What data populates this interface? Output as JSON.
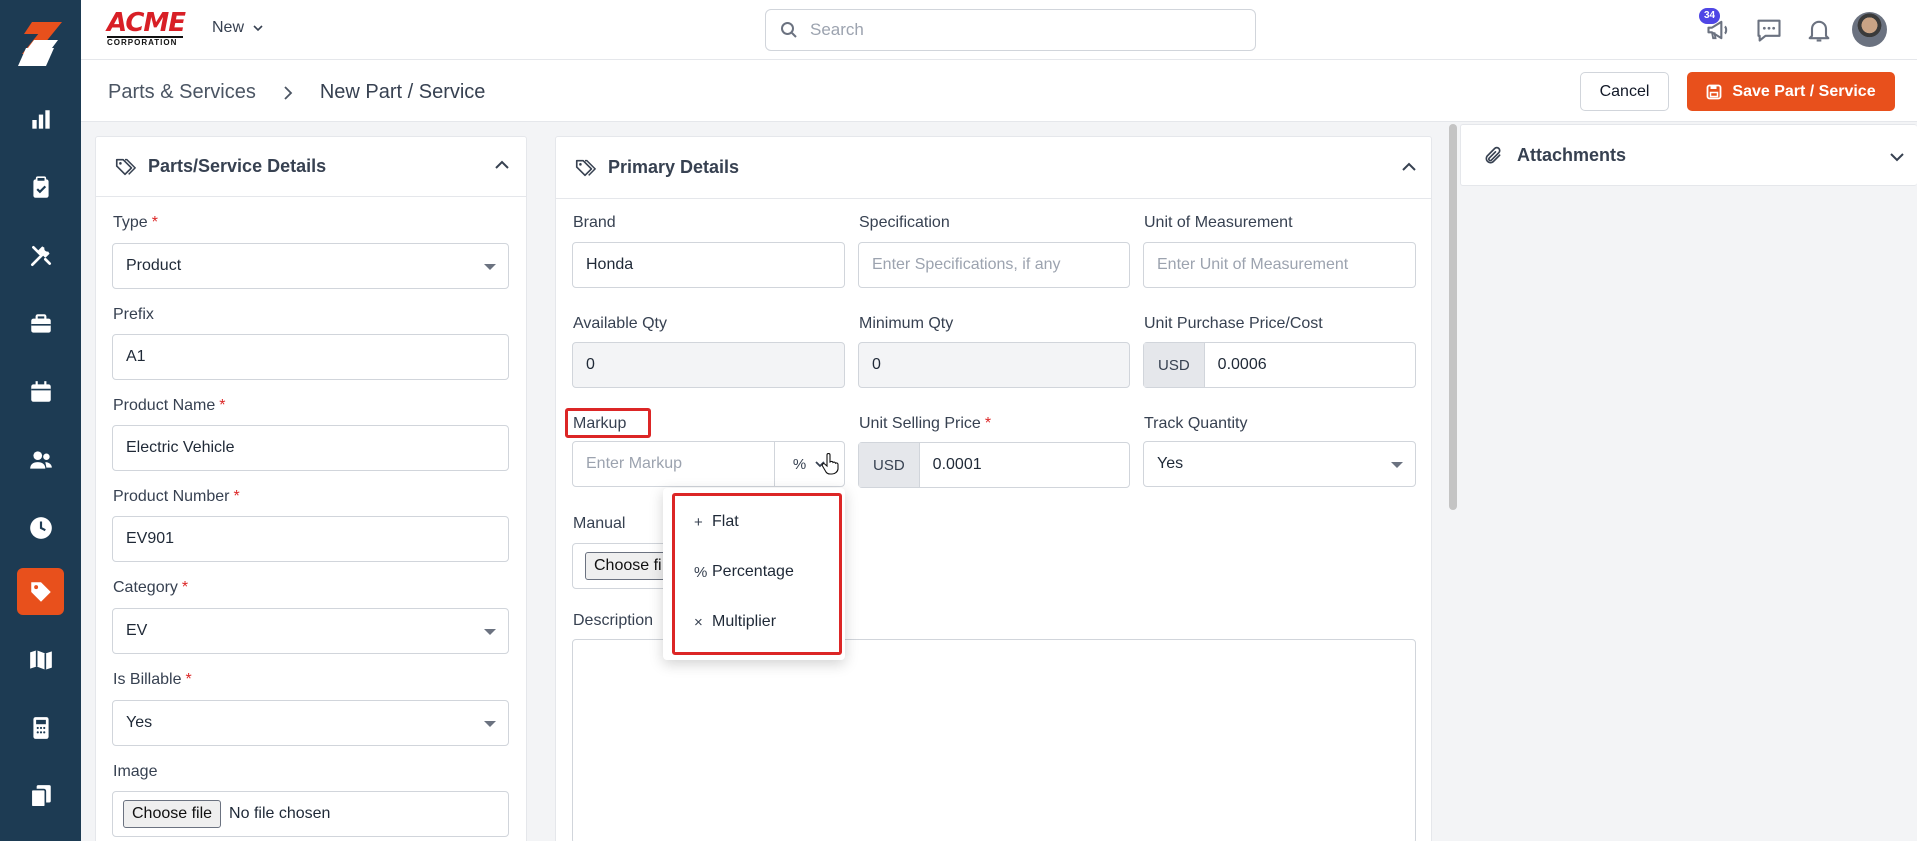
{
  "topbar": {
    "brand_main": "ACME",
    "brand_sub": "CORPORATION",
    "new_label": "New",
    "search_placeholder": "Search",
    "notification_count": "34"
  },
  "breadcrumb": {
    "parent": "Parts & Services",
    "current": "New Part / Service"
  },
  "actions": {
    "cancel": "Cancel",
    "save": "Save Part / Service"
  },
  "left_panel": {
    "title": "Parts/Service Details",
    "type_label": "Type",
    "type_value": "Product",
    "prefix_label": "Prefix",
    "prefix_value": "A1",
    "name_label": "Product Name",
    "name_value": "Electric Vehicle",
    "number_label": "Product Number",
    "number_value": "EV901",
    "category_label": "Category",
    "category_value": "EV",
    "billable_label": "Is Billable",
    "billable_value": "Yes",
    "image_label": "Image",
    "image_button": "Choose file",
    "image_status": "No file chosen"
  },
  "primary": {
    "title": "Primary Details",
    "brand_label": "Brand",
    "brand_value": "Honda",
    "spec_label": "Specification",
    "spec_placeholder": "Enter Specifications, if any",
    "uom_label": "Unit of Measurement",
    "uom_placeholder": "Enter Unit of Measurement",
    "avail_label": "Available Qty",
    "avail_value": "0",
    "min_label": "Minimum Qty",
    "min_value": "0",
    "cost_label": "Unit Purchase Price/Cost",
    "cost_currency": "USD",
    "cost_value": "0.0006",
    "markup_label": "Markup",
    "markup_placeholder": "Enter Markup",
    "selling_label": "Unit Selling Price",
    "selling_currency": "USD",
    "selling_value": "0.0001",
    "track_label": "Track Quantity",
    "track_value": "Yes",
    "manual_label": "Manual",
    "manual_button": "Choose fi",
    "description_label": "Description"
  },
  "markup_menu": {
    "items": [
      {
        "symbol": "+",
        "label": "Flat"
      },
      {
        "symbol": "%",
        "label": "Percentage"
      },
      {
        "symbol": "×",
        "label": "Multiplier"
      }
    ]
  },
  "attachments": {
    "title": "Attachments"
  },
  "colors": {
    "sidebar": "#1d3b53",
    "accent": "#e8501c",
    "highlight": "#dc2626"
  }
}
